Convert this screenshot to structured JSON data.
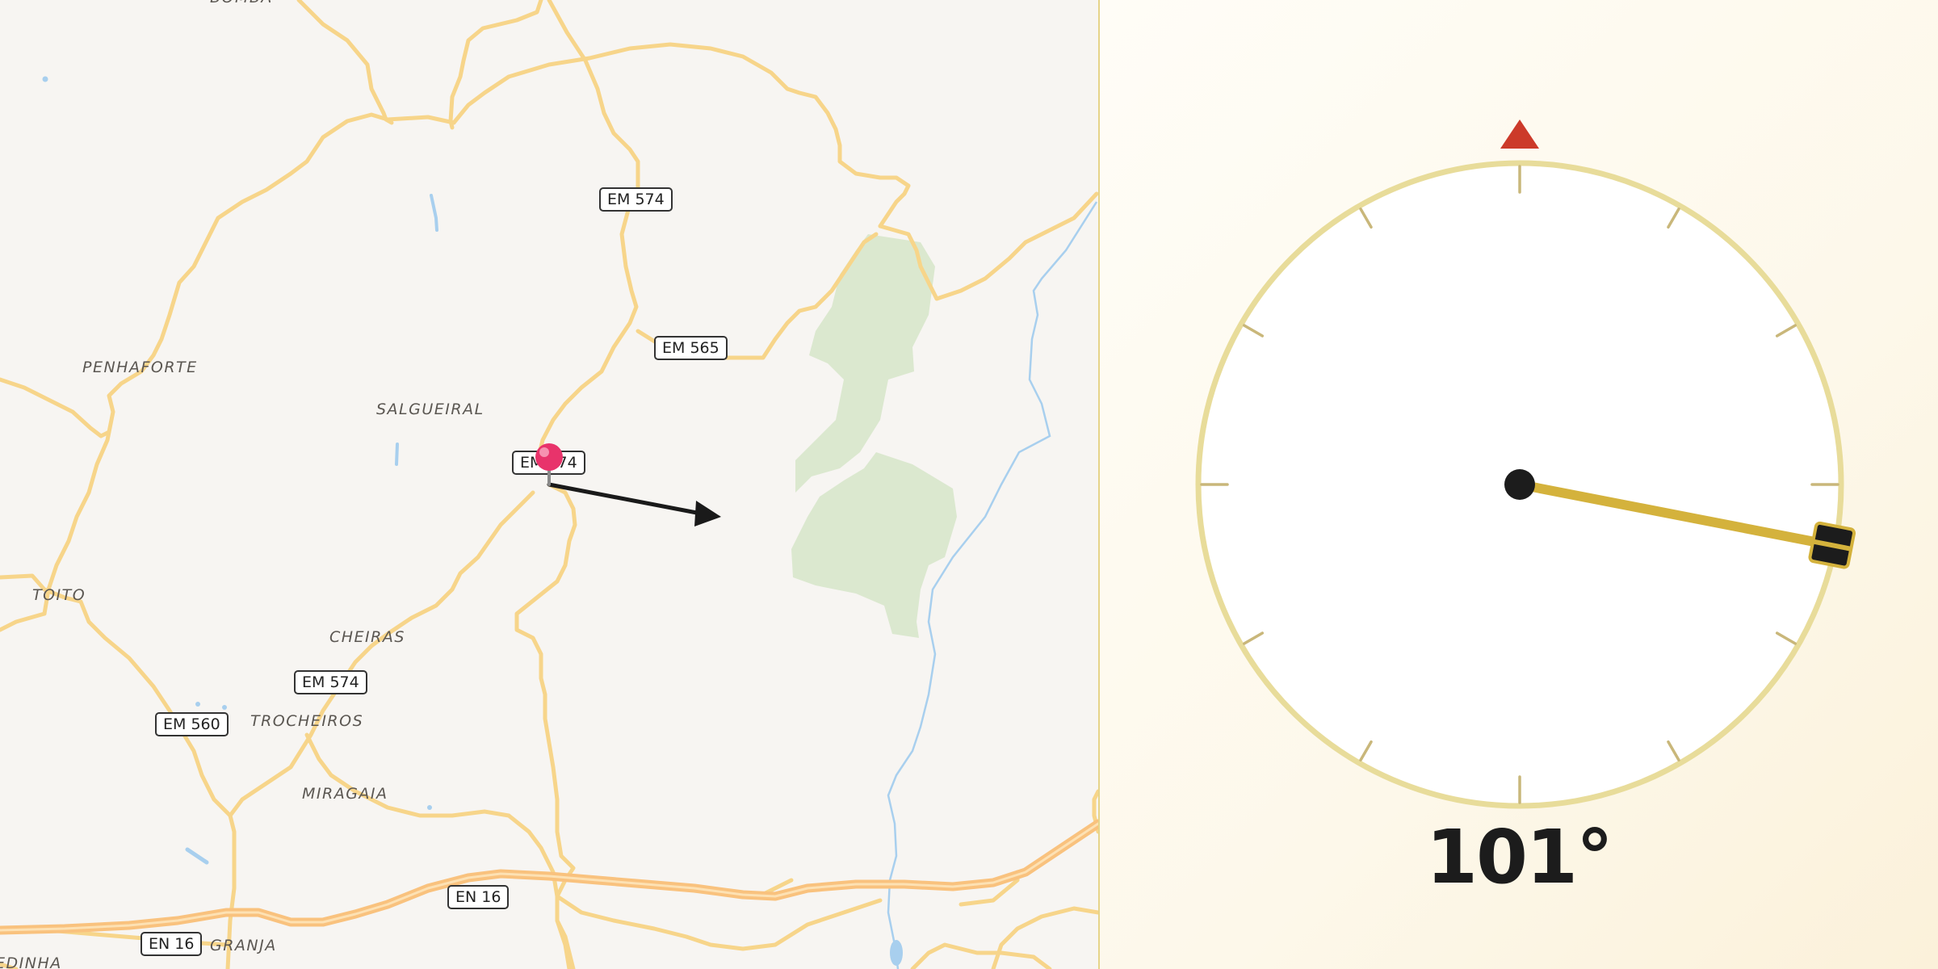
{
  "map": {
    "places": [
      {
        "id": "penhaforte",
        "label": "PENHAFORTE"
      },
      {
        "id": "salgueiral",
        "label": "SALGUEIRAL"
      },
      {
        "id": "toito",
        "label": "TOITO"
      },
      {
        "id": "cheiras",
        "label": "CHEIRAS"
      },
      {
        "id": "trocheiros",
        "label": "TROCHEIROS"
      },
      {
        "id": "miragaia",
        "label": "MIRAGAIA"
      },
      {
        "id": "granja",
        "label": "GRANJA"
      },
      {
        "id": "edinha",
        "label": "EDINHA"
      },
      {
        "id": "bomba",
        "label": "BOMBA"
      }
    ],
    "roads": [
      {
        "id": "em574-top",
        "label": "EM 574"
      },
      {
        "id": "em565",
        "label": "EM 565"
      },
      {
        "id": "em574-pin",
        "label": "EM 574"
      },
      {
        "id": "em574-low",
        "label": "EM 574"
      },
      {
        "id": "em560",
        "label": "EM 560"
      },
      {
        "id": "en16-mid",
        "label": "EN 16"
      },
      {
        "id": "en16-left",
        "label": "EN 16"
      }
    ],
    "pin_color": "#e8336b",
    "arrow_color": "#1a1a1a"
  },
  "compass": {
    "heading_deg": 101,
    "heading_label": "101°",
    "north_marker_color": "#cc3a2a",
    "needle_color": "#d4b23c",
    "dial_ring_color": "#e8dc9a"
  }
}
